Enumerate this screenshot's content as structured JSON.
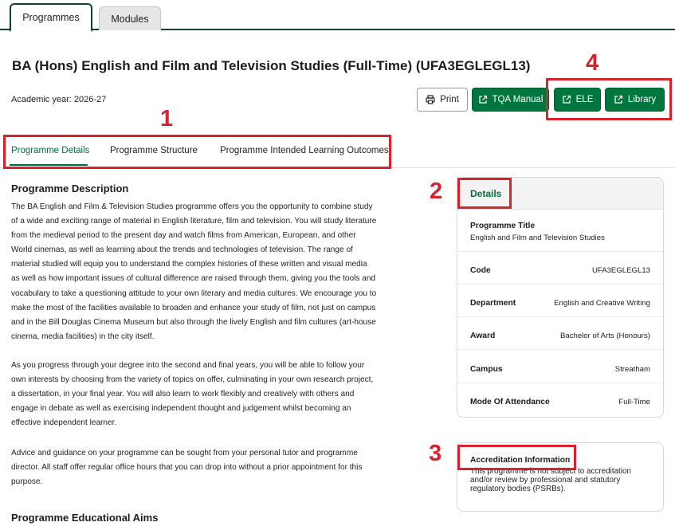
{
  "top_tabs": [
    {
      "label": "Programmes",
      "active": true
    },
    {
      "label": "Modules",
      "active": false
    }
  ],
  "header": {
    "title": "BA (Hons) English and Film and Television Studies (Full-Time) (UFA3EGLEGL13)",
    "academic_year": "Academic year: 2026-27"
  },
  "actions": {
    "print": {
      "label": "Print",
      "icon": "printer-icon"
    },
    "tqa": {
      "label": "TQA Manual",
      "icon": "external-link-icon"
    },
    "ele": {
      "label": "ELE",
      "icon": "external-link-icon"
    },
    "library": {
      "label": "Library",
      "icon": "external-link-icon"
    }
  },
  "programme_tabs": [
    {
      "label": "Programme Details",
      "active": true
    },
    {
      "label": "Programme Structure",
      "active": false
    },
    {
      "label": "Programme Intended Learning Outcomes",
      "active": false
    }
  ],
  "description": {
    "heading": "Programme Description",
    "paragraphs": [
      [
        "The BA English and Film & Television Studies programme offers you the opportunity to combine study",
        "of a wide and exciting range of material in English literature, film and television. You will study literature",
        "from the medieval period to the present day and watch films from American, European, and other",
        "World cinemas, as well as learning about the trends and technologies of television. The range of",
        "material studied will equip you to understand the complex histories of these written and visual media",
        "as well as how important issues of cultural difference are raised through them, giving you the tools and",
        "vocabulary to take a questioning attitude to your own literary and media cultures. We encourage you to",
        "make the most of the facilities available to broaden and enhance your study of film, not just on campus",
        "and in the Bill Douglas Cinema Museum but also through the lively English and film cultures (art-house",
        "cinema, media facilities) in the city itself."
      ],
      [
        "As you progress through your degree into the second and final years, you will be able to follow your",
        "own interests by choosing from the variety of topics on offer, culminating in your own research project,",
        "a dissertation, in your final year. You will also learn to work flexibly and creatively with others and",
        "engage in debate as well as exercising independent thought and judgement whilst becoming an",
        "effective independent learner."
      ],
      [
        "Advice and guidance on your programme can be sought from your personal tutor and programme",
        "director. All staff offer regular office hours that you can drop into without a prior appointment for this",
        "purpose."
      ]
    ]
  },
  "aims_heading": "Programme Educational Aims",
  "details": {
    "header": "Details",
    "programme_title_label": "Programme Title",
    "programme_title_value": "English and Film and Television Studies",
    "rows": [
      {
        "label": "Code",
        "value": "UFA3EGLEGL13"
      },
      {
        "label": "Department",
        "value": "English and Creative Writing"
      },
      {
        "label": "Award",
        "value": "Bachelor of Arts (Honours)"
      },
      {
        "label": "Campus",
        "value": "Streatham"
      },
      {
        "label": "Mode Of Attendance",
        "value": "Full-Time"
      }
    ]
  },
  "accreditation": {
    "title": "Accreditation Information",
    "text": "This programme is not subject to accreditation and/or review by professional and statutory regulatory bodies (PSRBs)."
  },
  "annotations": {
    "n1": "1",
    "n2": "2",
    "n3": "3",
    "n4": "4",
    "color": "#d9232c"
  },
  "colors": {
    "brand_green": "#00763f",
    "tab_green": "#00703c",
    "dark_border": "#123f2f"
  }
}
